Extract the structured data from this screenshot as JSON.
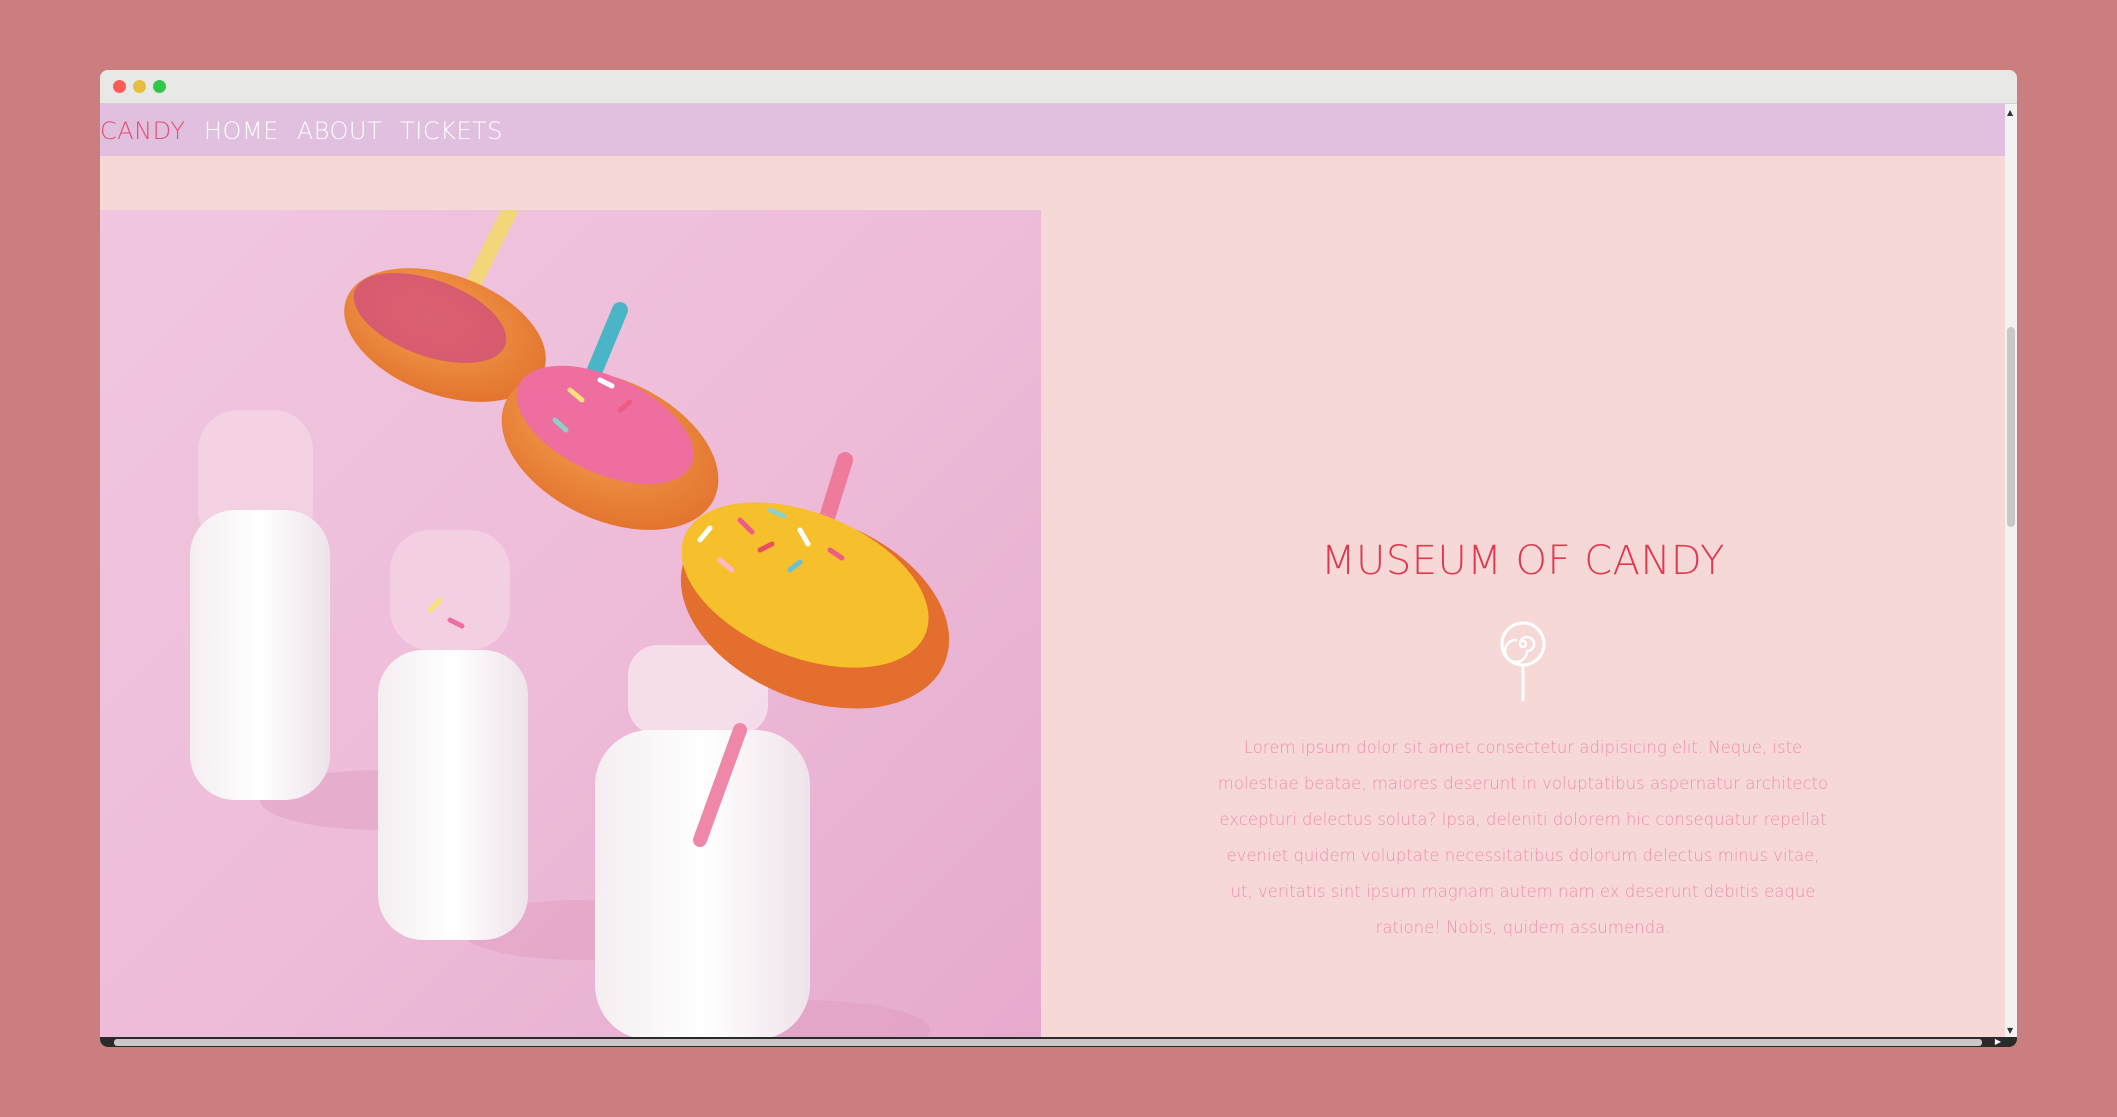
{
  "nav": {
    "brand": "CANDY",
    "links": [
      "HOME",
      "ABOUT",
      "TICKETS"
    ]
  },
  "hero": {
    "title": "MUSEUM OF CANDY",
    "body": "Lorem ipsum dolor sit amet consectetur adipisicing elit. Neque, iste molestiae beatae, maiores deserunt in voluptatibus aspernatur architecto excepturi delectus soluta? Ipsa, deleniti dolorem hic consequatur repellat eveniet quidem voluptate necessitatibus dolorum delectus minus vitae, ut, veritatis sint ipsum magnam autem nam ex deserunt debitis eaque ratione! Nobis, quidem assumenda.",
    "image": "donuts-on-milk-bottles",
    "icon": "lollipop-icon"
  },
  "colors": {
    "page_background": "#cb7e7e",
    "navbar": "#e0bfdf",
    "content_background": "#f6d9d6",
    "brand": "#e44d6b",
    "title": "#e0384f",
    "body_text": "#ef8fa7"
  },
  "scroll": {
    "vertical_position": 0.22
  }
}
